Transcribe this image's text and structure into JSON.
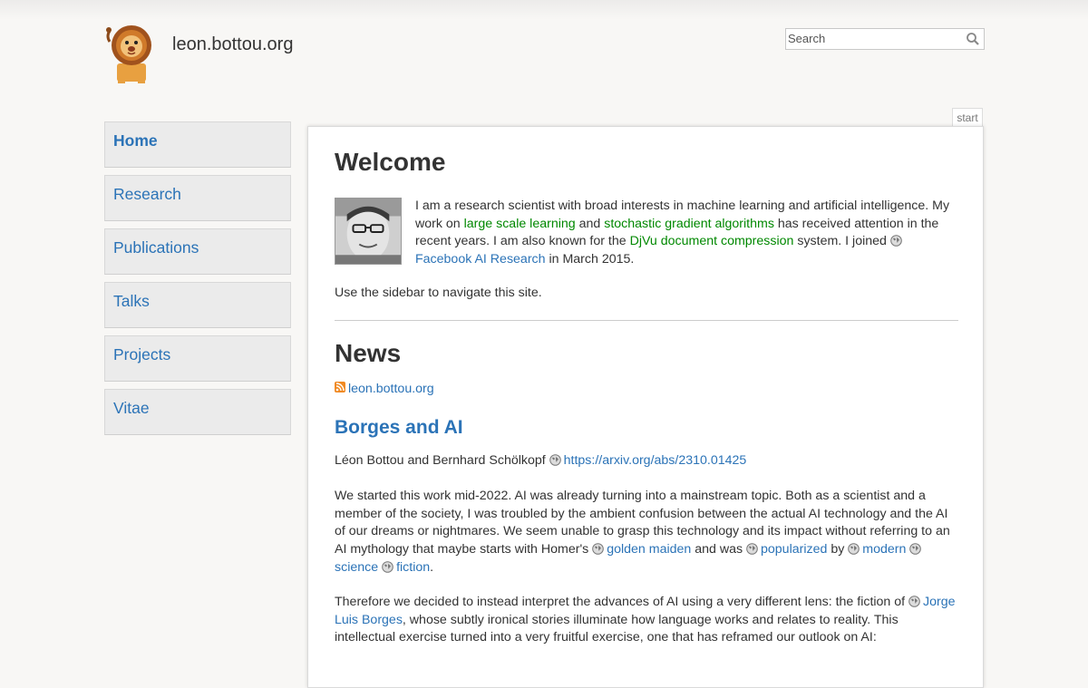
{
  "header": {
    "site_title": "leon.bottou.org",
    "logo_icon": "lion-logo",
    "search_placeholder": "Search",
    "search_icon": "magnifier-icon"
  },
  "sidebar": {
    "items": [
      {
        "label": "Home",
        "active": true
      },
      {
        "label": "Research",
        "active": false
      },
      {
        "label": "Publications",
        "active": false
      },
      {
        "label": "Talks",
        "active": false
      },
      {
        "label": "Projects",
        "active": false
      },
      {
        "label": "Vitae",
        "active": false
      }
    ]
  },
  "page_tab": "start",
  "welcome": {
    "title": "Welcome",
    "intro_1": "I am a research scientist with broad interests in machine learning and artificial intelligence. My work on ",
    "link_large_scale": "large scale learning",
    "intro_2": " and ",
    "link_sgd": "stochastic gradient algorithms",
    "intro_3": " has received attention in the recent years. I am also known for the ",
    "link_djvu": "DjVu document compression",
    "intro_4": " system. I joined ",
    "link_fair": "Facebook AI Research",
    "intro_5": " in March 2015.",
    "sidebar_hint": "Use the sidebar to navigate this site."
  },
  "news": {
    "title": "News",
    "feed_label": "leon.bottou.org",
    "post_title": "Borges and AI",
    "authors": "Léon Bottou and Bernhard Schölkopf ",
    "arxiv_link": "https://arxiv.org/abs/2310.01425",
    "p1_a": "We started this work mid-2022. AI was already turning into a mainstream topic. Both as a scientist and a member of the society, I was troubled by the ambient confusion between the actual AI technology and the AI of our dreams or nightmares. We seem unable to grasp this technology and its impact without referring to an AI mythology that maybe starts with Homer's ",
    "link_golden": "golden maiden",
    "p1_b": " and was ",
    "link_popularized": "popularized",
    "p1_c": " by ",
    "link_modern": "modern",
    "p1_d": " ",
    "link_science": "science",
    "p1_e": " ",
    "link_fiction": "fiction",
    "p1_f": ".",
    "p2_a": "Therefore we decided to instead interpret the advances of AI using a very different lens: the fiction of ",
    "link_borges": "Jorge Luis Borges",
    "p2_b": ", whose subtly ironical stories illuminate how language works and relates to reality. This intellectual exercise turned into a very fruitful exercise, one that has reframed our outlook on AI:"
  },
  "colors": {
    "link": "#2b73b7",
    "internal_link": "#008800",
    "nav_bg": "#ebebeb",
    "page_bg": "#f8f7f5"
  }
}
